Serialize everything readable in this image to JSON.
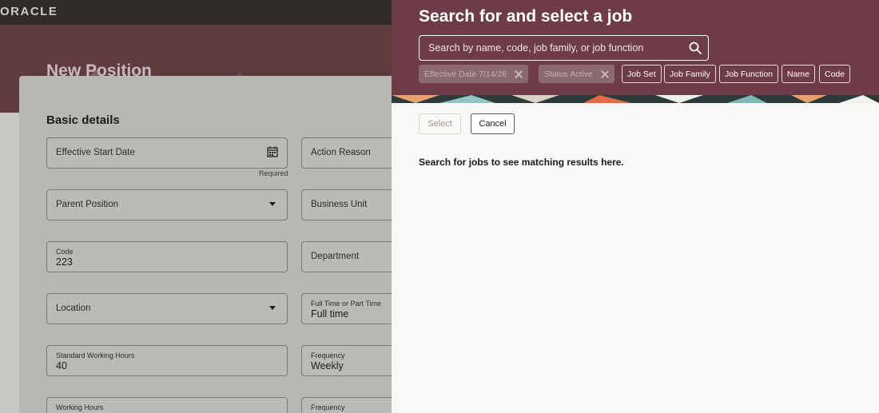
{
  "app": {
    "logo": "ORACLE"
  },
  "page": {
    "title": "New Position"
  },
  "basic_details": {
    "section_title": "Basic details",
    "fields": {
      "effective_start_date": {
        "label": "Effective Start Date",
        "hint": "Required"
      },
      "action_reason": {
        "label": "Action Reason"
      },
      "parent_position": {
        "label": "Parent Position"
      },
      "business_unit": {
        "label": "Business Unit"
      },
      "code": {
        "label": "Code",
        "value": "223"
      },
      "department": {
        "label": "Department"
      },
      "location": {
        "label": "Location"
      },
      "full_part_time": {
        "label": "Full Time or Part Time",
        "value": "Full time"
      },
      "standard_working_hours": {
        "label": "Standard Working Hours",
        "value": "40"
      },
      "frequency_1": {
        "label": "Frequency",
        "value": "Weekly"
      },
      "working_hours": {
        "label": "Working Hours"
      },
      "frequency_2": {
        "label": "Frequency"
      }
    }
  },
  "drawer": {
    "title": "Search for and select a job",
    "search": {
      "placeholder": "Search by name, code, job family, or job function"
    },
    "applied_filters": [
      {
        "label": "Effective Date 7/14/26"
      },
      {
        "label": "Status Active"
      }
    ],
    "filters": [
      {
        "label": "Job Set"
      },
      {
        "label": "Job Family"
      },
      {
        "label": "Job Function"
      },
      {
        "label": "Name"
      },
      {
        "label": "Code"
      }
    ],
    "buttons": {
      "select": "Select",
      "cancel": "Cancel"
    },
    "empty_message": "Search for jobs to see matching results here."
  },
  "colors": {
    "drawer_header": "#6e3c46",
    "page_header_dimmed": "#5f3a3f",
    "topbar": "#2e2b28",
    "drawer_body": "#f9f8f6"
  },
  "icons": {
    "search": "search-icon",
    "calendar": "calendar-icon",
    "dropdown": "chevron-down-icon",
    "remove": "close-icon"
  }
}
